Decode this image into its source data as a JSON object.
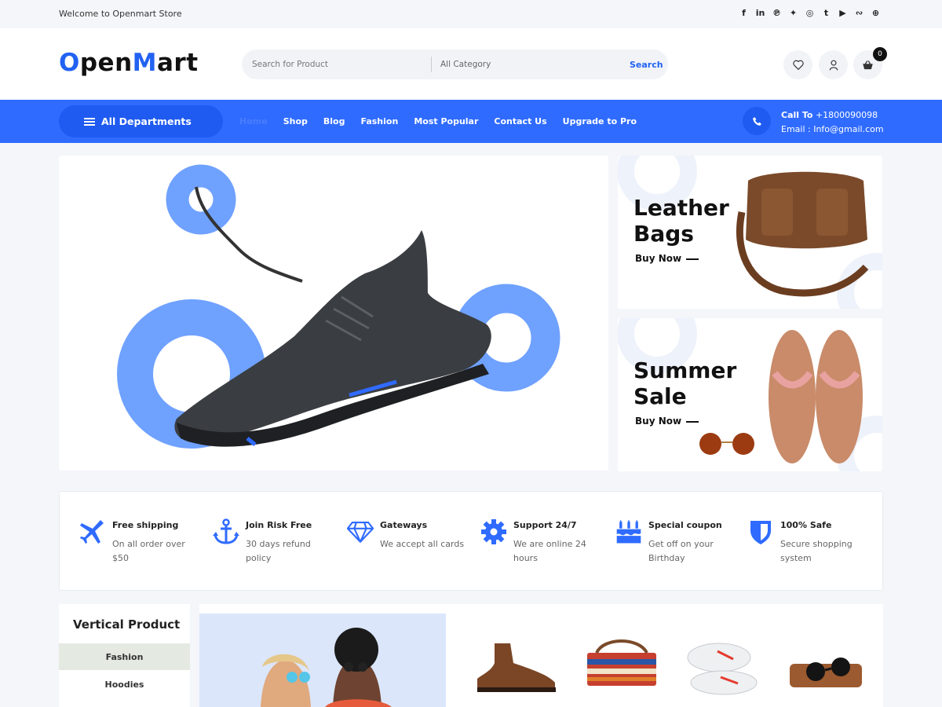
{
  "topbar": {
    "welcome": "Welcome to Openmart Store",
    "socials": [
      "facebook-icon",
      "linkedin-icon",
      "pinterest-icon",
      "twitter-icon",
      "instagram-icon",
      "tumblr-icon",
      "youtube-icon",
      "stumbleupon-icon",
      "dribbble-icon"
    ]
  },
  "header": {
    "logo_part1": "O",
    "logo_part2": "pen",
    "logo_part3": "M",
    "logo_part4": "art",
    "search_placeholder": "Search for Product",
    "category": "All Category",
    "search_button": "Search",
    "cart_count": "0"
  },
  "nav": {
    "all_departments": "All Departments",
    "items": [
      "Home",
      "Shop",
      "Blog",
      "Fashion",
      "Most Popular",
      "Contact Us",
      "Upgrade to Pro"
    ],
    "call_label": "Call To",
    "call_number": "+1800090098",
    "email": "Email : Info@gmail.com"
  },
  "promos": [
    {
      "title_line1": "Leather",
      "title_line2": "Bags",
      "cta": "Buy Now"
    },
    {
      "title_line1": "Summer",
      "title_line2": "Sale",
      "cta": "Buy Now"
    }
  ],
  "features": [
    {
      "title": "Free shipping",
      "desc": "On all order over $50",
      "icon": "airplane-icon"
    },
    {
      "title": "Join Risk Free",
      "desc": "30 days refund policy",
      "icon": "anchor-icon"
    },
    {
      "title": "Gateways",
      "desc": "We accept all cards",
      "icon": "diamond-icon"
    },
    {
      "title": "Support 24/7",
      "desc": "We are online 24 hours",
      "icon": "gear-icon"
    },
    {
      "title": "Special coupon",
      "desc": "Get off on your Birthday",
      "icon": "birthday-cake-icon"
    },
    {
      "title": "100% Safe",
      "desc": "Secure shopping system",
      "icon": "shield-icon"
    }
  ],
  "vertical_product": {
    "title": "Vertical Product",
    "categories": [
      "Fashion",
      "Hoodies"
    ]
  },
  "colors": {
    "brand": "#2f6bff",
    "accent_ring": "#6fa1ff"
  }
}
